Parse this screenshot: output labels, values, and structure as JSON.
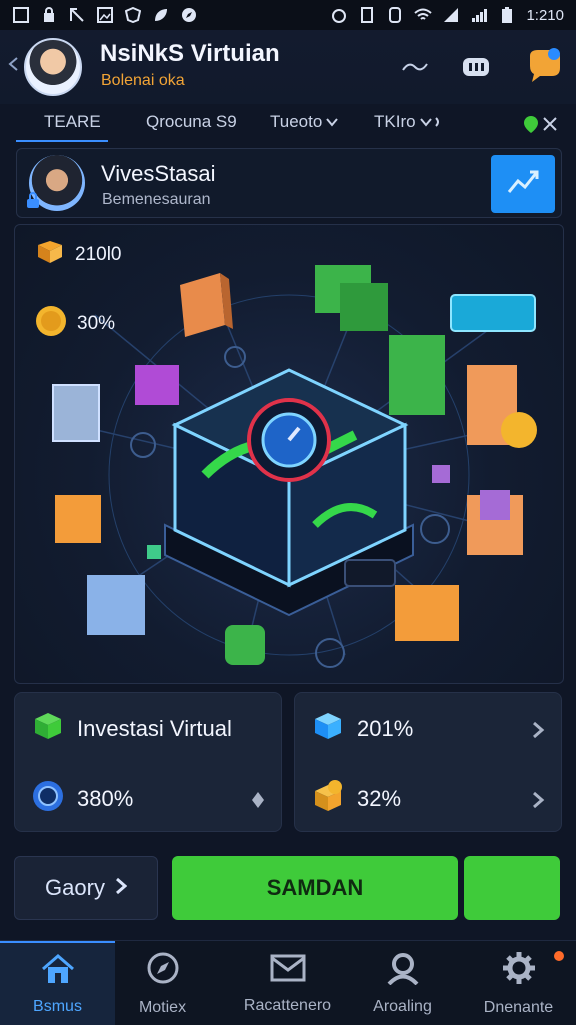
{
  "status_bar": {
    "time": "1:210"
  },
  "header": {
    "title": "NsiNkS Virtuian",
    "subtitle": "Bolenai oka"
  },
  "tabs": [
    {
      "label": "TEARE"
    },
    {
      "label": "Qrocuna S9"
    },
    {
      "label": "Tueoto"
    },
    {
      "label": "TKIro"
    }
  ],
  "profile": {
    "name": "VivesStasai",
    "subtitle": "Bemenesauran"
  },
  "hero": {
    "stat1": "210l0",
    "stat2": "30%"
  },
  "cards": {
    "left": {
      "row1": "Investasi Virtual",
      "row2": "380%"
    },
    "right": {
      "row1": "201%",
      "row2": "32%"
    }
  },
  "actions": {
    "gaory_label": "Gaory",
    "samdan_label": "SAMDAN"
  },
  "bottom_nav": [
    {
      "label": "Bsmus"
    },
    {
      "label": "Motiex"
    },
    {
      "label": "Racattenero"
    },
    {
      "label": "Aroaling"
    },
    {
      "label": "Dnenante"
    }
  ],
  "colors": {
    "accent_blue": "#3a8eff",
    "accent_green": "#3fcb3a",
    "accent_orange": "#f2a436"
  }
}
